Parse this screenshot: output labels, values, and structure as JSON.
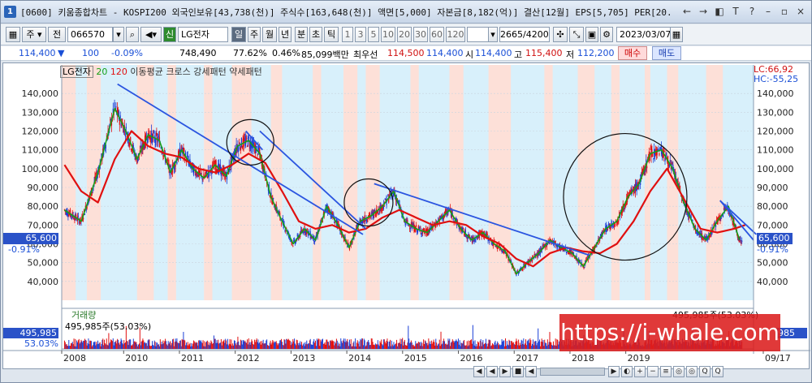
{
  "title_bar": {
    "text": "[0600] 키움종합차트 - KOSPI200 외국인보유[43,738(천)] 주식수[163,648(천)] 액면[5,000] 자본금[8,182(억)] 결산[12월] EPS[5,705] PER[20.",
    "icon_label": "1",
    "controls": [
      "←",
      "→",
      "◧",
      "T",
      "?",
      "–",
      "▫",
      "×"
    ]
  },
  "toolbar": {
    "period_select": "주",
    "prev_label": "전",
    "code_value": "066570",
    "sin_label": "신",
    "stock_name": "LG전자",
    "period_buttons": [
      "일",
      "주",
      "월",
      "년",
      "분",
      "초",
      "틱"
    ],
    "numeric_buttons": [
      "1",
      "3",
      "5",
      "10",
      "20",
      "30",
      "60",
      "120"
    ],
    "count_display": "2665",
    "count_total": "/4200",
    "date_value": "2023/03/07"
  },
  "price_row": {
    "price": "114,400",
    "change_arrow": "▼",
    "change": "100",
    "change_pct": "-0.09%",
    "volume": "748,490",
    "ratio": "77.62%",
    "turnover": "0.46%",
    "amount": "85,099백만",
    "best_label": "최우선",
    "best_price": "114,500",
    "best_price2": "114,400",
    "open_label": "시",
    "open": "114,400",
    "high_label": "고",
    "high": "115,400",
    "low_label": "저",
    "low": "112,200",
    "buy_label": "매수",
    "sell_label": "매도"
  },
  "legend": {
    "stock": "LG전자",
    "ma1": "20",
    "ma2": "120",
    "patterns": "이동평균 크로스 강세패턴  약세패턴"
  },
  "right_indicator": {
    "lc": "LC:66,92",
    "hc": "HC:-55,25"
  },
  "current_price_tag": {
    "value": "65,600",
    "pct": "-0.91%"
  },
  "volume_panel": {
    "label": "거래량",
    "value_text": "495,985주(53.03%)",
    "left_value": "495,985",
    "left_pct": "53.03%",
    "right_value": "985"
  },
  "watermark": "https://i-whale.com",
  "x_labels": [
    "2008",
    "2010",
    "2011",
    "2012",
    "2013",
    "2014",
    "2015",
    "2016",
    "2017",
    "2018",
    "2019",
    "09/17"
  ],
  "bottom_controls": [
    "◀",
    "◀",
    "▶",
    "■",
    "◀",
    "▶",
    "◐",
    "+",
    "−",
    "≡",
    "◎",
    "◎",
    "Q",
    "Q"
  ],
  "chart_data": {
    "type": "line",
    "title": "",
    "xlabel": "",
    "ylabel": "",
    "ylim": [
      30000,
      150000
    ],
    "y_ticks": [
      "140,000",
      "130,000",
      "120,000",
      "110,000",
      "100,000",
      "90,000",
      "80,000",
      "70,000",
      "60,000",
      "50,000",
      "40,000"
    ],
    "series": [
      {
        "name": "20",
        "color": "#16a016",
        "x": [
          2007.6,
          2007.9,
          2008.2,
          2008.5,
          2008.7,
          2008.9,
          2009.1,
          2009.3,
          2009.5,
          2009.7,
          2009.9,
          2010.1,
          2010.3,
          2010.5,
          2010.7,
          2010.9,
          2011.1,
          2011.3,
          2011.5,
          2011.7,
          2011.9,
          2012.1,
          2012.3,
          2012.5,
          2012.7,
          2012.9,
          2013.1,
          2013.3,
          2013.5,
          2013.7,
          2013.9,
          2014.1,
          2014.3,
          2014.5,
          2014.7,
          2014.9,
          2015.1,
          2015.3,
          2015.5,
          2015.7,
          2015.9,
          2016.1,
          2016.3,
          2016.5,
          2016.7,
          2016.9,
          2017.1,
          2017.3,
          2017.5,
          2017.7,
          2017.9,
          2018.1,
          2018.3,
          2018.5,
          2018.7,
          2018.9,
          2019.1,
          2019.3,
          2019.5,
          2019.7
        ],
        "values": [
          78000,
          72000,
          98000,
          132000,
          120000,
          105000,
          118000,
          115000,
          98000,
          110000,
          100000,
          95000,
          102000,
          96000,
          112000,
          115000,
          108000,
          85000,
          72000,
          60000,
          68000,
          62000,
          80000,
          70000,
          58000,
          72000,
          75000,
          80000,
          88000,
          72000,
          68000,
          66000,
          72000,
          78000,
          68000,
          62000,
          66000,
          60000,
          56000,
          44000,
          50000,
          55000,
          62000,
          58000,
          55000,
          48000,
          58000,
          68000,
          72000,
          85000,
          92000,
          108000,
          110000,
          100000,
          82000,
          68000,
          62000,
          72000,
          80000,
          62000
        ]
      },
      {
        "name": "120",
        "color": "#e01010",
        "x": [
          2007.6,
          2007.9,
          2008.2,
          2008.5,
          2008.8,
          2009.1,
          2009.4,
          2009.7,
          2010.0,
          2010.3,
          2010.6,
          2010.9,
          2011.2,
          2011.5,
          2011.8,
          2012.1,
          2012.4,
          2012.7,
          2013.0,
          2013.3,
          2013.6,
          2013.9,
          2014.2,
          2014.5,
          2014.8,
          2015.1,
          2015.4,
          2015.7,
          2016.0,
          2016.3,
          2016.6,
          2016.9,
          2017.2,
          2017.5,
          2017.8,
          2018.1,
          2018.4,
          2018.7,
          2019.0,
          2019.3,
          2019.6,
          2019.8
        ],
        "values": [
          102000,
          88000,
          82000,
          105000,
          120000,
          112000,
          108000,
          106000,
          100000,
          98000,
          102000,
          108000,
          103000,
          88000,
          72000,
          68000,
          70000,
          66000,
          68000,
          74000,
          78000,
          74000,
          70000,
          72000,
          70000,
          64000,
          60000,
          52000,
          48000,
          55000,
          58000,
          56000,
          55000,
          60000,
          72000,
          88000,
          100000,
          84000,
          68000,
          66000,
          68000,
          70000
        ]
      }
    ],
    "trendlines_color": "#2b55e0",
    "highlight_colors": {
      "bull": "#d8f0fb",
      "bear": "#fde0d8"
    }
  }
}
